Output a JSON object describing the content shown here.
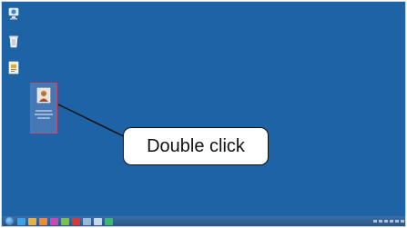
{
  "desktop": {
    "background_color": "#1d63a6",
    "icons": [
      {
        "name": "network-icon"
      },
      {
        "name": "recycle-bin-icon"
      },
      {
        "name": "shortcut-icon"
      }
    ],
    "selected_file": {
      "name": "image-file-icon",
      "state": "selected"
    }
  },
  "callout": {
    "text": "Double click"
  },
  "taskbar": {
    "buttons": [
      {
        "name": "taskbar-ie-icon",
        "color": "#3aa0e8"
      },
      {
        "name": "taskbar-folder-icon",
        "color": "#e8b040"
      },
      {
        "name": "taskbar-media-icon",
        "color": "#f08a30"
      },
      {
        "name": "taskbar-app-icon",
        "color": "#c84ab0"
      },
      {
        "name": "taskbar-paint-icon",
        "color": "#7dbd4a"
      },
      {
        "name": "taskbar-red-app-icon",
        "color": "#d83a3a"
      },
      {
        "name": "taskbar-window-icon",
        "color": "#9ab8d8"
      },
      {
        "name": "taskbar-window2-icon",
        "color": "#c8d8e8"
      },
      {
        "name": "taskbar-green-app-icon",
        "color": "#3ab870"
      }
    ]
  }
}
